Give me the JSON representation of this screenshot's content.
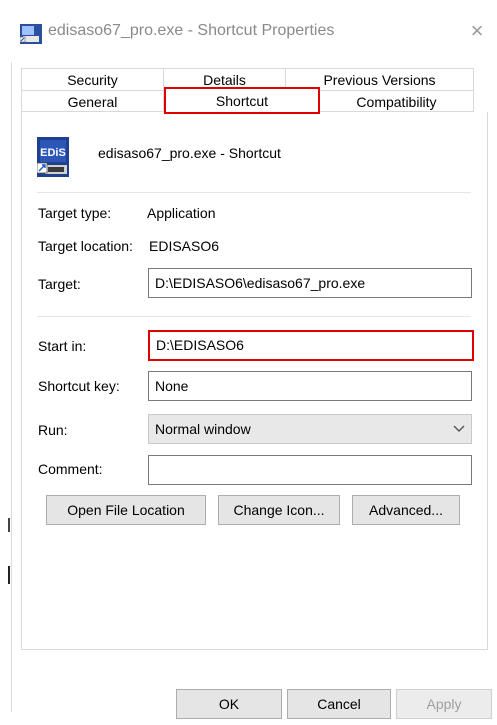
{
  "window": {
    "title": "edisaso67_pro.exe - Shortcut Properties",
    "close_glyph": "×",
    "app_icon": "shortcut-app-icon"
  },
  "tabs": {
    "row1": [
      "Security",
      "Details",
      "Previous Versions"
    ],
    "row2": [
      "General",
      "Shortcut",
      "Compatibility"
    ],
    "active": "Shortcut"
  },
  "shortcut": {
    "icon": "edis-program-icon",
    "icon_text": "EDiS",
    "name": "edisaso67_pro.exe - Shortcut"
  },
  "fields": {
    "target_type_label": "Target type:",
    "target_type_value": "Application",
    "target_location_label": "Target location:",
    "target_location_value": "EDISASO6",
    "target_label": "Target:",
    "target_value": "D:\\EDISASO6\\edisaso67_pro.exe",
    "start_in_label": "Start in:",
    "start_in_value": "D:\\EDISASO6",
    "shortcut_key_label": "Shortcut key:",
    "shortcut_key_value": "None",
    "run_label": "Run:",
    "run_value": "Normal window",
    "comment_label": "Comment:",
    "comment_value": ""
  },
  "buttons": {
    "open_file_location": "Open File Location",
    "change_icon": "Change Icon...",
    "advanced": "Advanced...",
    "ok": "OK",
    "cancel": "Cancel",
    "apply": "Apply"
  },
  "colors": {
    "highlight": "#e00000",
    "icon_blue": "#1f3f8f"
  }
}
